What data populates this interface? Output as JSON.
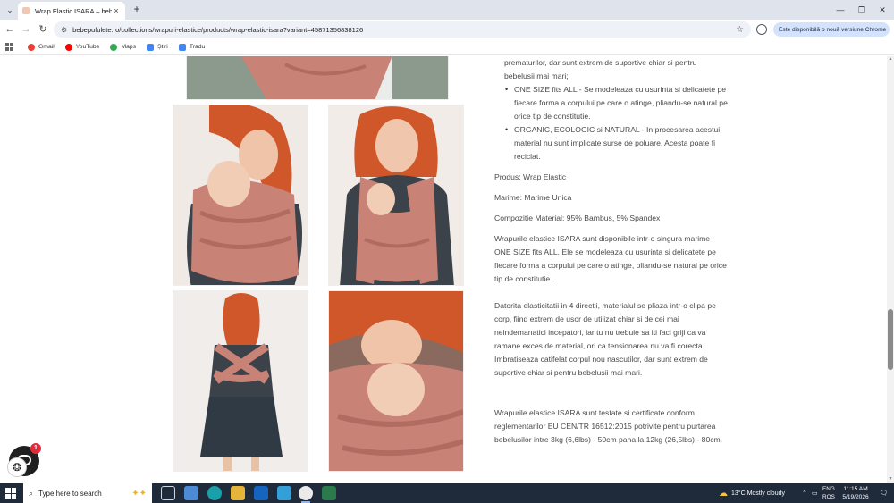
{
  "browser": {
    "tab_title": "Wrap Elastic ISARA – bebepuf...",
    "tab_close": "×",
    "new_tab": "+",
    "url": "bebepufulete.ro/collections/wrapuri-elastice/products/wrap-elastic-isara?variant=45871356838126",
    "update_pill": "Este disponibilă o nouă versiune Chrome",
    "bookmarks": [
      {
        "label": "Gmail",
        "color": "#ea4335"
      },
      {
        "label": "YouTube",
        "color": "#ff0000"
      },
      {
        "label": "Maps",
        "color": "#34a853"
      },
      {
        "label": "Știri",
        "color": "#4285f4"
      },
      {
        "label": "Tradu",
        "color": "#4285f4"
      }
    ]
  },
  "description": {
    "line_top_a": "prematurilor, dar sunt extrem de suportive chiar si pentru",
    "line_top_b": "bebelusii mai mari;",
    "bullets": [
      "ONE SIZE fits ALL - Se modeleaza cu usurinta si delicatete pe fiecare forma a corpului pe care o atinge, pliandu-se natural pe orice tip de constitutie.",
      "ORGANIC, ECOLOGIC si NATURAL - In procesarea acestui material nu sunt implicate surse de poluare. Acesta poate fi reciclat."
    ],
    "produs": "Produs: Wrap Elastic",
    "marime": "Marime: Marime Unica",
    "compozitie": "Compozitie Material: 95% Bambus, 5% Spandex",
    "para1": "Wrapurile elastice ISARA sunt disponibile intr-o singura marime ONE SIZE fits ALL. Ele se modeleaza cu usurinta si delicatete pe fiecare forma a corpului pe care o atinge, pliandu-se natural pe orice tip de constitutie.",
    "para2": "Datorita elasticitatii in 4 directii, materialul se pliaza intr-o clipa pe corp, fiind extrem de usor de utilizat chiar si de cei mai neindemanatici incepatori, iar tu nu trebuie sa iti faci griji ca va ramane exces de material, ori ca tensionarea nu va fi corecta. Imbratiseaza catifelat corpul nou nascutilor, dar sunt extrem de suportive chiar si pentru bebelusii mai mari.",
    "para3": "Wrapurile elastice ISARA sunt testate si certificate conform reglementarilor EU CEN/TR 16512:2015 potrivite pentru purtarea bebelusilor intre 3kg (6,6lbs) - 50cm pana la 12kg (26,5lbs) - 80cm."
  },
  "chat": {
    "badge": "1"
  },
  "taskbar": {
    "search_placeholder": "Type here to search",
    "weather": "13°C  Mostly cloudy",
    "lang_top": "ENG",
    "lang_bottom": "ROS",
    "time": "11:15 AM",
    "date": "5/19/2026"
  },
  "colors": {
    "wrap_pink": "#c98276",
    "hair": "#d0572a",
    "shirt": "#3b424a",
    "photo_bg": "#efeae6"
  }
}
